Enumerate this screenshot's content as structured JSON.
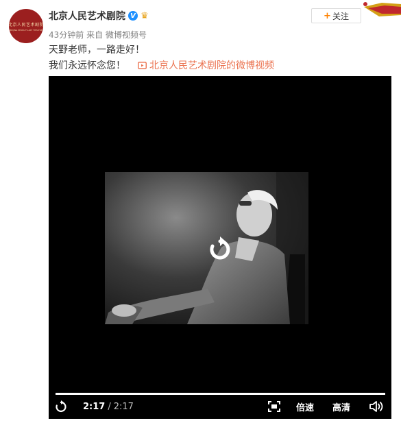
{
  "account": {
    "name": "北京人民艺术剧院",
    "avatar_text": "北京人民艺术剧院",
    "avatar_subtext": "BEIJING PEOPLE'S ART THEATRE",
    "verified_icon": "verified-badge-icon",
    "crown_icon": "crown-icon"
  },
  "post": {
    "time": "43分钟前",
    "source_prefix": "来自",
    "source": "微博视频号",
    "line1": "天野老师，一路走好！",
    "line2": "我们永远怀念您！",
    "video_link": "北京人民艺术剧院的微博视频"
  },
  "follow_button": {
    "label": "关注",
    "icon": "plus-icon"
  },
  "player": {
    "current_time": "2:17",
    "separator": "/",
    "duration": "2:17",
    "progress": 1.0,
    "speed_label": "倍速",
    "quality_label": "高清",
    "icons": [
      "replay-icon",
      "fullscreen-icon",
      "volume-icon"
    ]
  },
  "colors": {
    "link": "#eb7350",
    "follow_plus": "#ff8200",
    "verified": "#1e90ff",
    "avatar_bg": "#9b1f1f"
  }
}
